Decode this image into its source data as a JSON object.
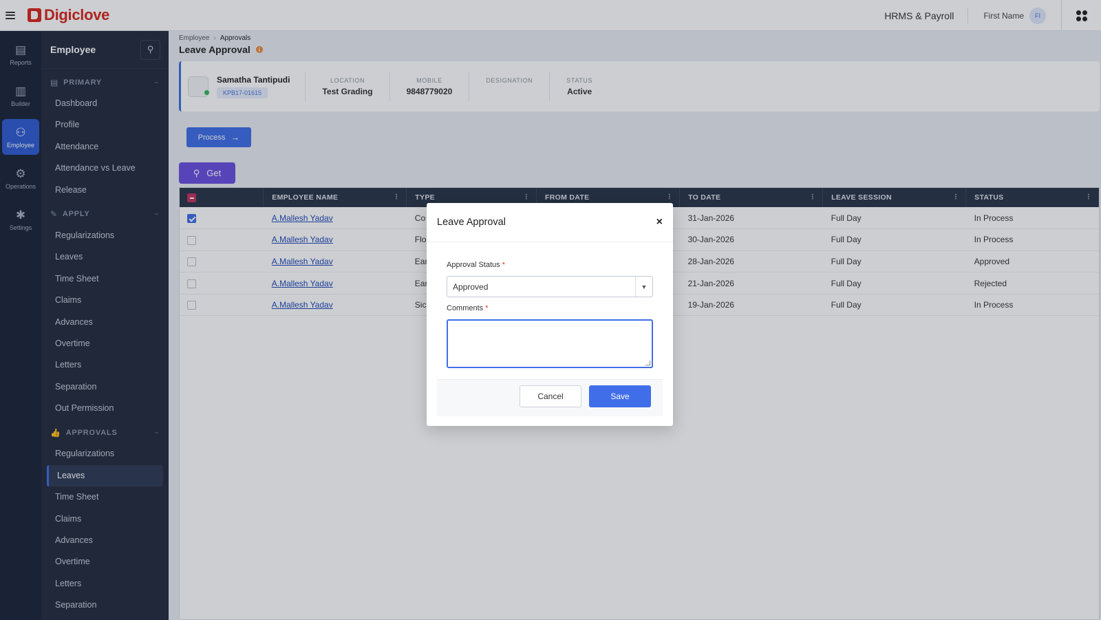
{
  "topbar": {
    "logo_text": "Digiclove",
    "app_name": "HRMS & Payroll",
    "user_name": "First Name",
    "avatar_initials": "FI"
  },
  "rail": [
    {
      "label": "Reports",
      "icon": "reports-icon",
      "glyph": "▤",
      "active": false
    },
    {
      "label": "Builder",
      "icon": "bar-chart-icon",
      "glyph": "▥",
      "active": false
    },
    {
      "label": "Employee",
      "icon": "employee-icon",
      "glyph": "⚇",
      "active": true
    },
    {
      "label": "Operations",
      "icon": "operations-icon",
      "glyph": "⚙",
      "active": false
    },
    {
      "label": "Settings",
      "icon": "gear-icon",
      "glyph": "✱",
      "active": false
    }
  ],
  "sidebar": {
    "title": "Employee",
    "sections": [
      {
        "label": "PRIMARY",
        "items": [
          "Dashboard",
          "Profile",
          "Attendance",
          "Attendance vs Leave",
          "Release"
        ]
      },
      {
        "label": "APPLY",
        "items": [
          "Regularizations",
          "Leaves",
          "Time Sheet",
          "Claims",
          "Advances",
          "Overtime",
          "Letters",
          "Separation",
          "Out Permission"
        ]
      },
      {
        "label": "APPROVALS",
        "items": [
          "Regularizations",
          "Leaves",
          "Time Sheet",
          "Claims",
          "Advances",
          "Overtime",
          "Letters",
          "Separation"
        ],
        "active_item": "Leaves"
      }
    ]
  },
  "breadcrumb": {
    "parent": "Employee",
    "current": "Approvals"
  },
  "page_title": "Leave Approval",
  "employee": {
    "name": "Samatha Tantipudi",
    "code": "KPB17-01615",
    "location_label": "LOCATION",
    "location": "Test Grading",
    "mobile_label": "MOBILE",
    "mobile": "9848779020",
    "designation_label": "DESIGNATION",
    "designation": "",
    "status_label": "STATUS",
    "status": "Active"
  },
  "buttons": {
    "process": "Process",
    "get": "Get"
  },
  "table": {
    "columns": [
      "EMPLOYEE NAME",
      "TYPE",
      "FROM DATE",
      "TO DATE",
      "LEAVE SESSION",
      "STATUS"
    ],
    "rows": [
      {
        "checked": true,
        "name": "A.Mallesh Yadav",
        "type": "Co",
        "from": "",
        "to": "31-Jan-2026",
        "session": "Full Day",
        "status": "In Process"
      },
      {
        "checked": false,
        "name": "A.Mallesh Yadav",
        "type": "Flo",
        "from": "",
        "to": "30-Jan-2026",
        "session": "Full Day",
        "status": "In Process"
      },
      {
        "checked": false,
        "name": "A.Mallesh Yadav",
        "type": "Ear",
        "from": "",
        "to": "28-Jan-2026",
        "session": "Full Day",
        "status": "Approved"
      },
      {
        "checked": false,
        "name": "A.Mallesh Yadav",
        "type": "Ear",
        "from": "",
        "to": "21-Jan-2026",
        "session": "Full Day",
        "status": "Rejected"
      },
      {
        "checked": false,
        "name": "A.Mallesh Yadav",
        "type": "Sic",
        "from": "",
        "to": "19-Jan-2026",
        "session": "Full Day",
        "status": "In Process"
      }
    ]
  },
  "modal": {
    "title": "Leave Approval",
    "close": "×",
    "approval_status_label": "Approval Status",
    "approval_status_value": "Approved",
    "comments_label": "Comments",
    "comments_value": "",
    "required_mark": "*",
    "cancel": "Cancel",
    "save": "Save"
  }
}
